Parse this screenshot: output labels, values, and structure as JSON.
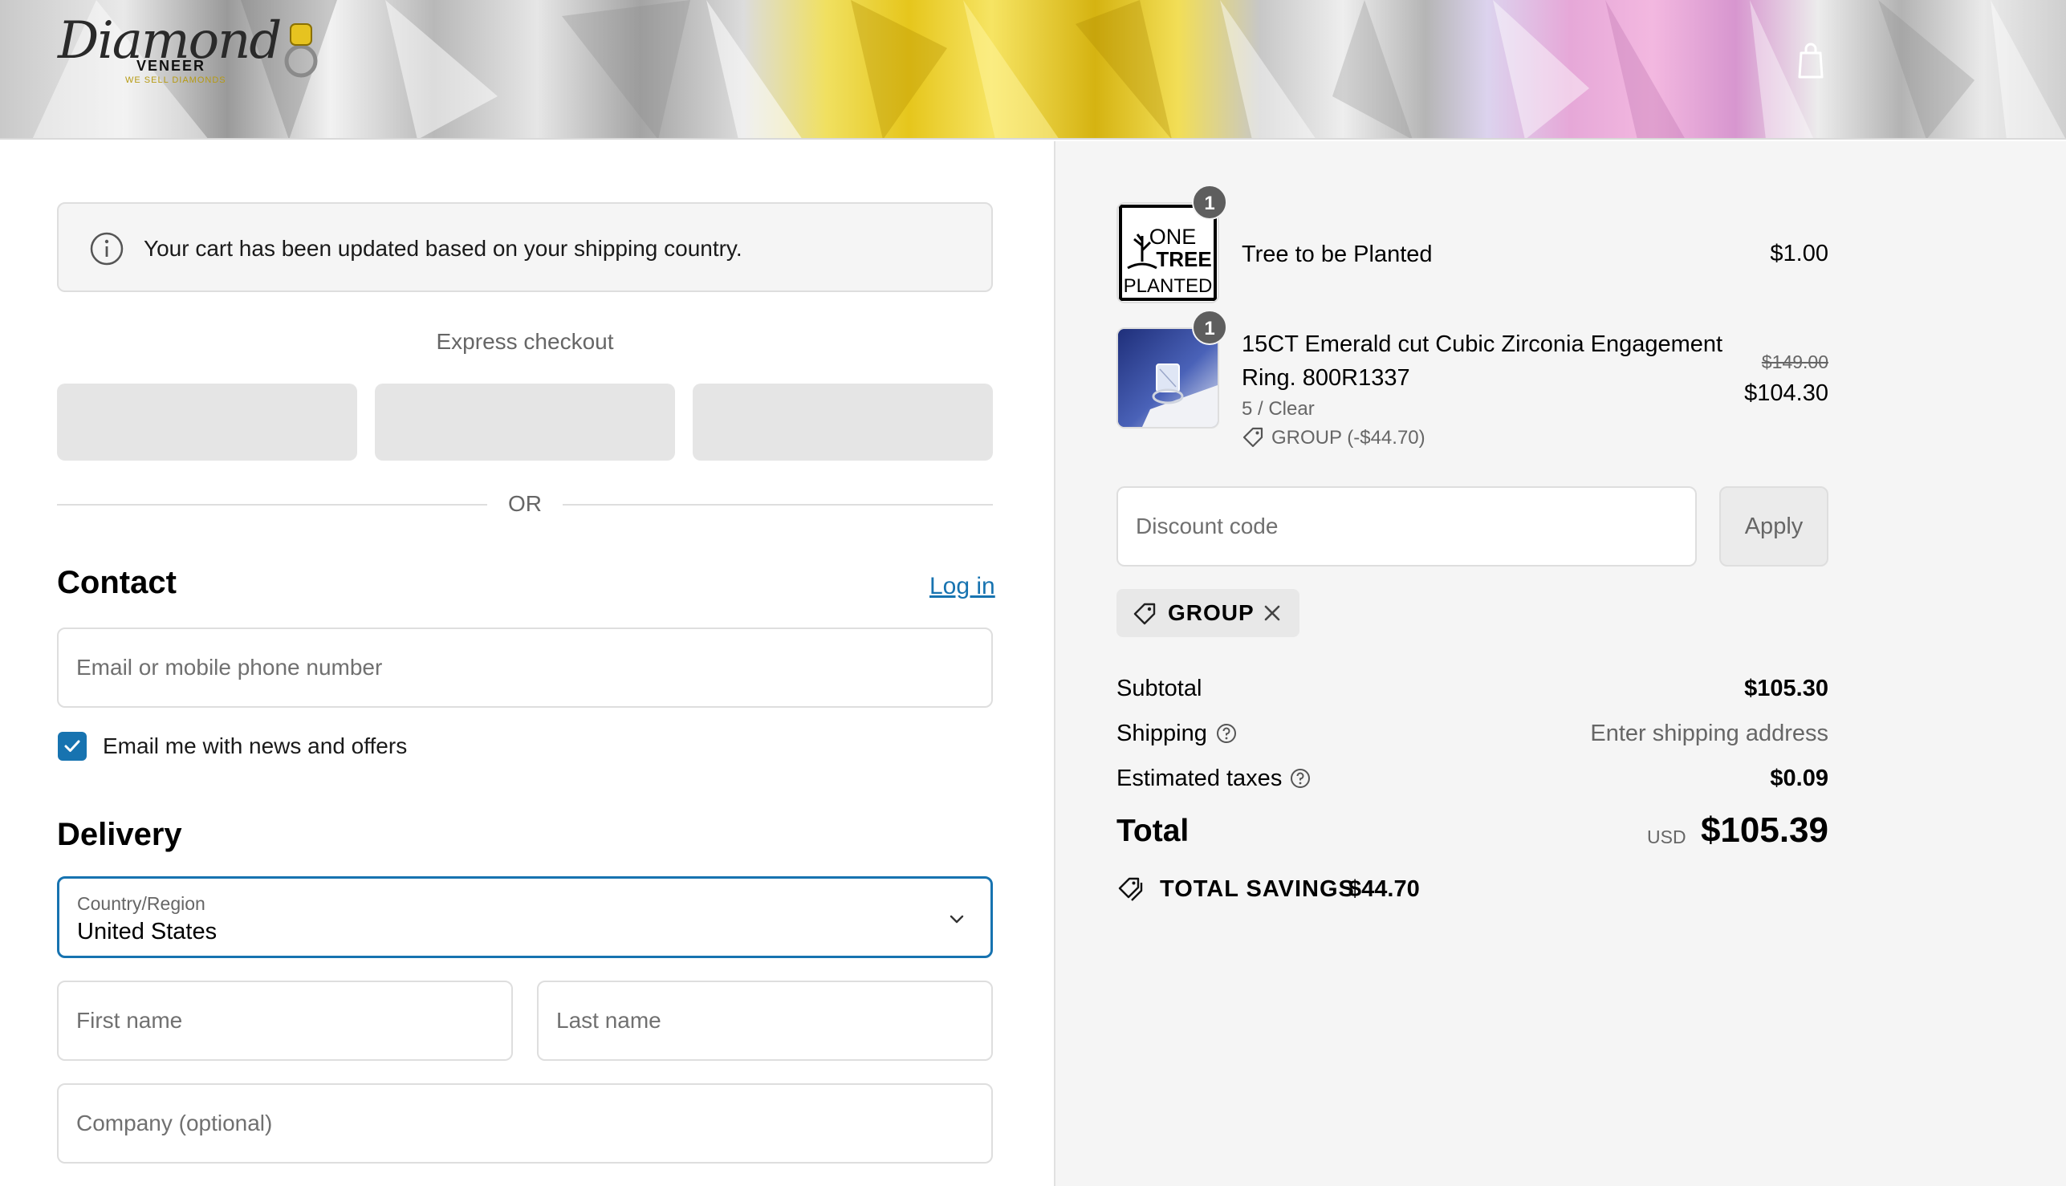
{
  "header": {
    "logo_script": "Diamond",
    "logo_word": "VENEER",
    "logo_tagline": "WE SELL DIAMONDS"
  },
  "notice": {
    "text": "Your cart has been updated based on your shipping country."
  },
  "express": {
    "label": "Express checkout",
    "or_text": "OR"
  },
  "contact": {
    "title": "Contact",
    "login_label": "Log in",
    "email_placeholder": "Email or mobile phone number",
    "newsletter_label": "Email me with news and offers",
    "newsletter_checked": true
  },
  "delivery": {
    "title": "Delivery",
    "country_label": "Country/Region",
    "country_value": "United States",
    "first_name_placeholder": "First name",
    "last_name_placeholder": "Last name",
    "company_placeholder": "Company (optional)"
  },
  "cart": {
    "items": [
      {
        "name": "Tree to be Planted",
        "quantity": "1",
        "price": "$1.00",
        "thumb_text": [
          "ONE",
          "TREE",
          "PLANTED"
        ]
      },
      {
        "name_line1": "15CT Emerald cut Cubic Zirconia Engagement",
        "name_line2": "Ring. 800R1337",
        "quantity": "1",
        "variant": "5 / Clear",
        "discount": "GROUP (-$44.70)",
        "original_price": "$149.00",
        "price": "$104.30"
      }
    ]
  },
  "discount": {
    "placeholder": "Discount code",
    "apply_label": "Apply",
    "applied_code": "GROUP"
  },
  "summary": {
    "subtotal_label": "Subtotal",
    "subtotal_value": "$105.30",
    "shipping_label": "Shipping",
    "shipping_value": "Enter shipping address",
    "taxes_label": "Estimated taxes",
    "taxes_value": "$0.09",
    "total_label": "Total",
    "currency": "USD",
    "total_value": "$105.39",
    "savings_label": "TOTAL SAVINGS",
    "savings_value": "$44.70"
  },
  "colors": {
    "accent": "#1773b0",
    "summary_bg": "#f5f5f5",
    "muted_text": "#666666"
  }
}
